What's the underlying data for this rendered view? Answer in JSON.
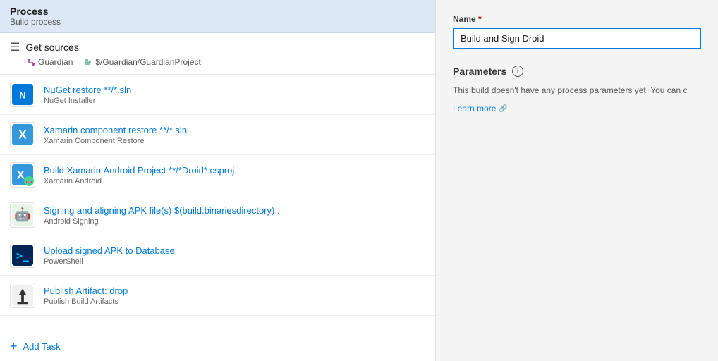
{
  "left_panel": {
    "header": {
      "title": "Process",
      "subtitle": "Build process"
    },
    "get_sources": {
      "title": "Get sources",
      "branch": "Guardian",
      "path": "$/Guardian/GuardianProject"
    },
    "tasks": [
      {
        "id": "nuget",
        "name": "NuGet restore **/*.sln",
        "type": "NuGet Installer",
        "icon_type": "nuget",
        "icon_label": "N"
      },
      {
        "id": "xamarin-component",
        "name": "Xamarin component restore **/*.sln",
        "type": "Xamarin Component Restore",
        "icon_type": "xamarin",
        "icon_label": "X"
      },
      {
        "id": "xamarin-android",
        "name": "Build Xamarin.Android Project **/*Droid*.csproj",
        "type": "Xamarin.Android",
        "icon_type": "xamarin-android",
        "icon_label": "X"
      },
      {
        "id": "signing",
        "name": "Signing and aligning APK file(s) $(build.binariesdirectory)..",
        "type": "Android Signing",
        "icon_type": "android",
        "icon_label": "🤖"
      },
      {
        "id": "powershell",
        "name": "Upload signed APK to Database",
        "type": "PowerShell",
        "icon_type": "powershell",
        "icon_label": ">"
      },
      {
        "id": "publish",
        "name": "Publish Artifact: drop",
        "type": "Publish Build Artifacts",
        "icon_type": "publish",
        "icon_label": "⬆"
      }
    ],
    "add_task_label": "Add Task"
  },
  "right_panel": {
    "name_label": "Name",
    "name_required": "*",
    "name_value": "Build and Sign Droid",
    "parameters_label": "Parameters",
    "parameters_desc": "This build doesn't have any process parameters yet. You can c",
    "learn_more_label": "Learn more"
  }
}
